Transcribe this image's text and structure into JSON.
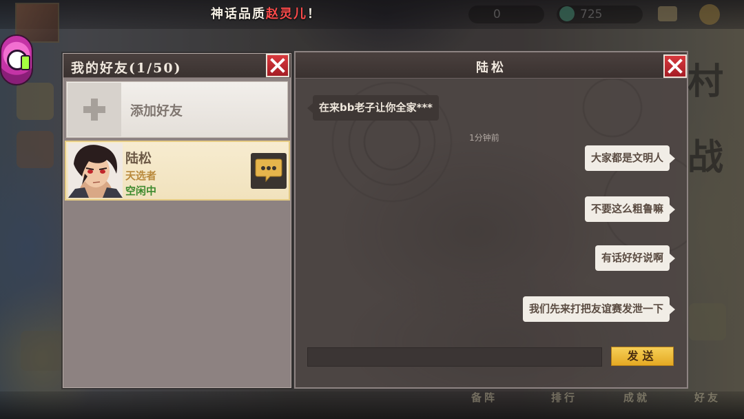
{
  "announcement": {
    "prefix": "神话品质",
    "highlight": "赵灵儿",
    "suffix": "！"
  },
  "background": {
    "resource_1": "0",
    "resource_2": "725",
    "bottom_menu": [
      "备阵",
      "排行",
      "成就",
      "好友"
    ],
    "side_chars": [
      "村",
      "战"
    ]
  },
  "friends_panel": {
    "title": "我的好友",
    "count": "(1/50)",
    "add_friend_label": "添加好友",
    "friends": [
      {
        "name": "陆松",
        "title": "天选者",
        "status": "空闲中"
      }
    ]
  },
  "chat_panel": {
    "title": "陆松",
    "timestamp": "1分钟前",
    "messages": [
      {
        "direction": "in",
        "text": "在来bb老子让你全家***"
      },
      {
        "direction": "out",
        "text": "大家都是文明人"
      },
      {
        "direction": "out",
        "text": "不要这么粗鲁嘛"
      },
      {
        "direction": "out",
        "text": "有话好好说啊"
      },
      {
        "direction": "out",
        "text": "我们先来打把友谊赛发泄一下"
      }
    ],
    "input_value": "",
    "send_label": "发送"
  },
  "colors": {
    "close_red": "#c72a31",
    "send_gold": "#f0c040",
    "status_green": "#3d8a2e",
    "title_gold": "#b98a3d",
    "announce_highlight": "#ff4b4b"
  },
  "icons": {
    "close": "close-icon",
    "add": "plus-icon",
    "chat": "chat-bubble-icon"
  }
}
